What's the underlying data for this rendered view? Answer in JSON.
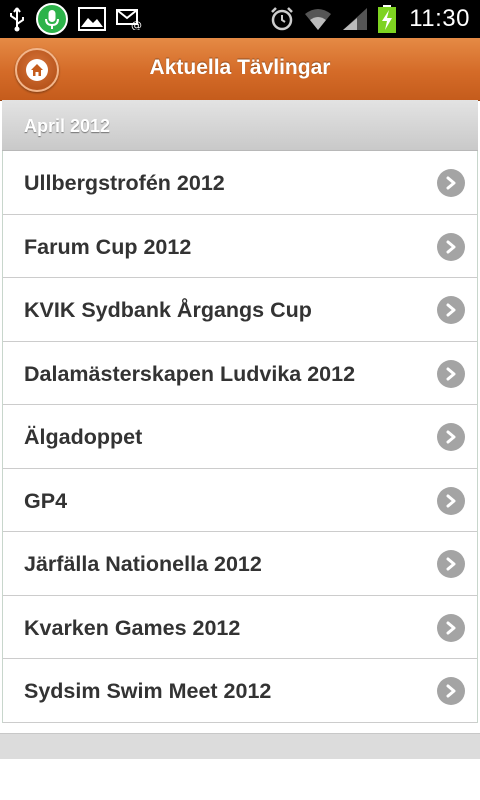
{
  "status_bar": {
    "time": "11:30",
    "icons_left": [
      "usb-icon",
      "mic-icon",
      "gallery-icon",
      "email-icon"
    ],
    "icons_right": [
      "alarm-icon",
      "wifi-icon",
      "signal-icon",
      "battery-charging-icon"
    ],
    "mic_color": "#2db34a",
    "battery_color": "#7ed321"
  },
  "header": {
    "title": "Aktuella Tävlingar",
    "home_icon": "home-icon",
    "accent_color": "#d46b28"
  },
  "section": {
    "label": "April 2012"
  },
  "items": [
    {
      "label": "Ullbergstrofén 2012"
    },
    {
      "label": "Farum Cup 2012"
    },
    {
      "label": "KVIK Sydbank Årgangs Cup"
    },
    {
      "label": "Dalamästerskapen Ludvika 2012"
    },
    {
      "label": "Älgadoppet"
    },
    {
      "label": "GP4"
    },
    {
      "label": "Järfälla Nationella 2012"
    },
    {
      "label": "Kvarken Games 2012"
    },
    {
      "label": "Sydsim Swim Meet 2012"
    }
  ]
}
